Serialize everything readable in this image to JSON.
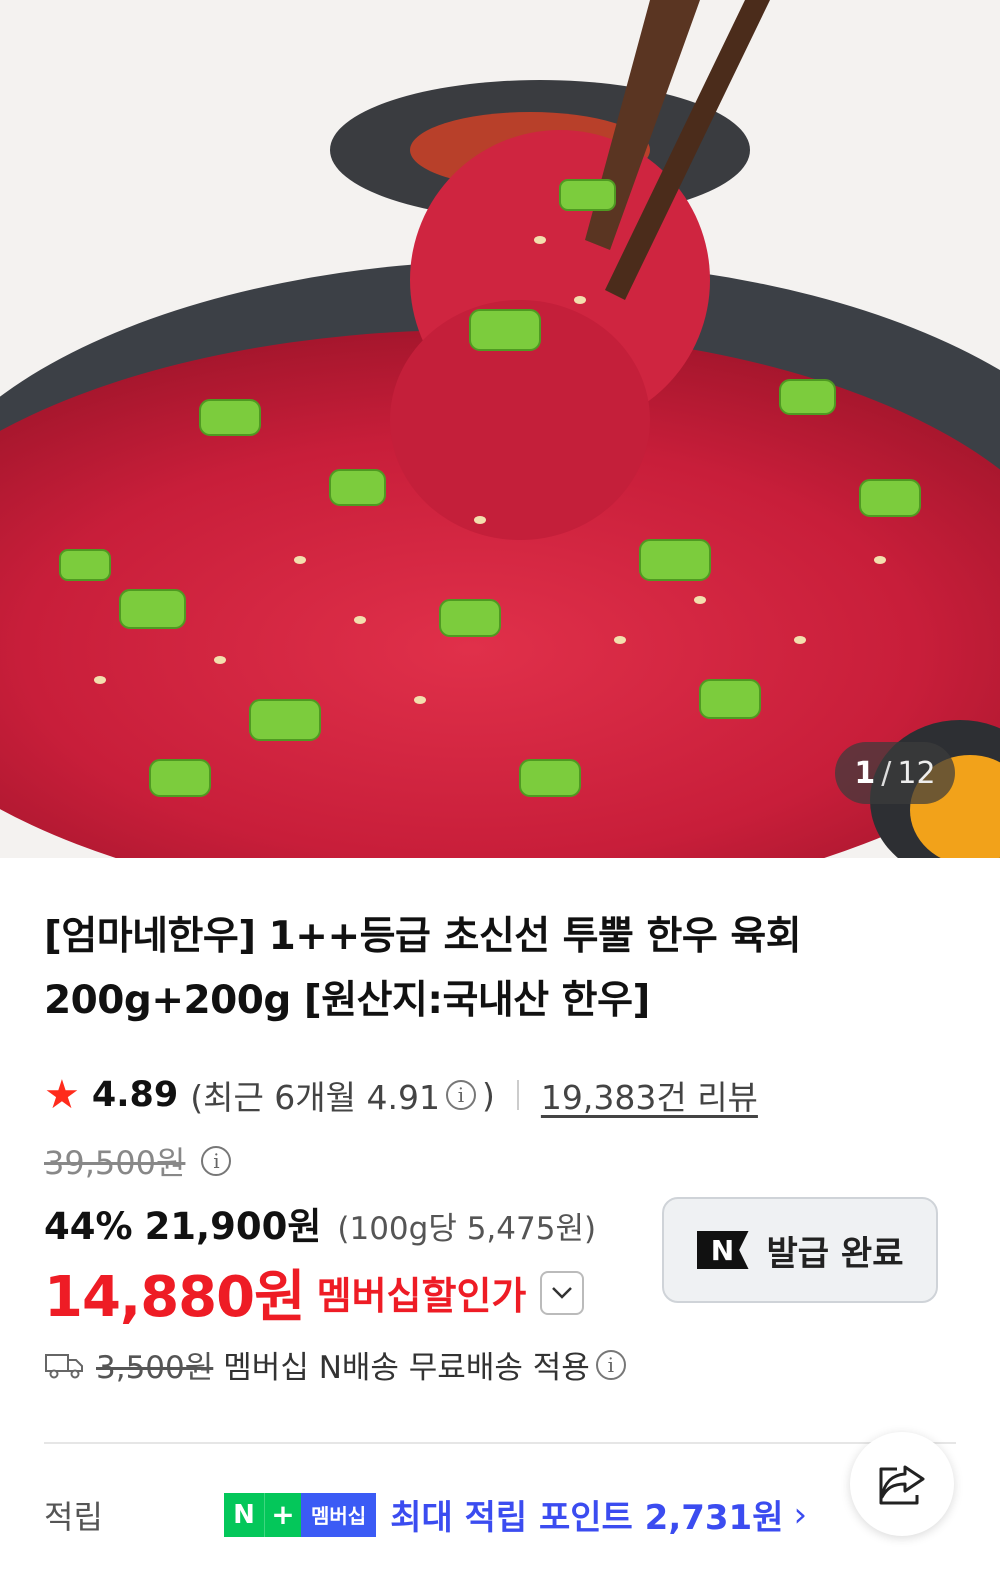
{
  "image": {
    "current": "1",
    "separator": "/",
    "total": "12"
  },
  "product": {
    "title_line1": "[엄마네한우] 1++등급 초신선 투뿔 한우 육회",
    "title_line2": "200g+200g [원산지:국내산 한우]"
  },
  "rating": {
    "score": "4.89",
    "recent_prefix": "(최근 6개월 4.91",
    "recent_suffix": ")",
    "reviews": "19,383건 리뷰",
    "icon": "star-icon"
  },
  "price": {
    "original": "39,500원",
    "discount_pct": "44%",
    "sale": "21,900원",
    "unit_price": "(100g당 5,475원)",
    "member_price": "14,880원",
    "member_label": "멤버십할인가"
  },
  "coupon": {
    "badge": "N",
    "label": "발급 완료"
  },
  "shipping": {
    "original_fee": "3,500원",
    "text": "멤버십 N배송 무료배송 적용"
  },
  "points": {
    "label": "적립",
    "badge_n": "N",
    "badge_plus": "+",
    "badge_member": "멤버십",
    "text": "최대 적립 포인트 2,731원",
    "arrow": "›"
  },
  "colors": {
    "accent_red": "#ee1c25",
    "point_blue": "#3b4cf0",
    "naver_green": "#04c75a"
  }
}
